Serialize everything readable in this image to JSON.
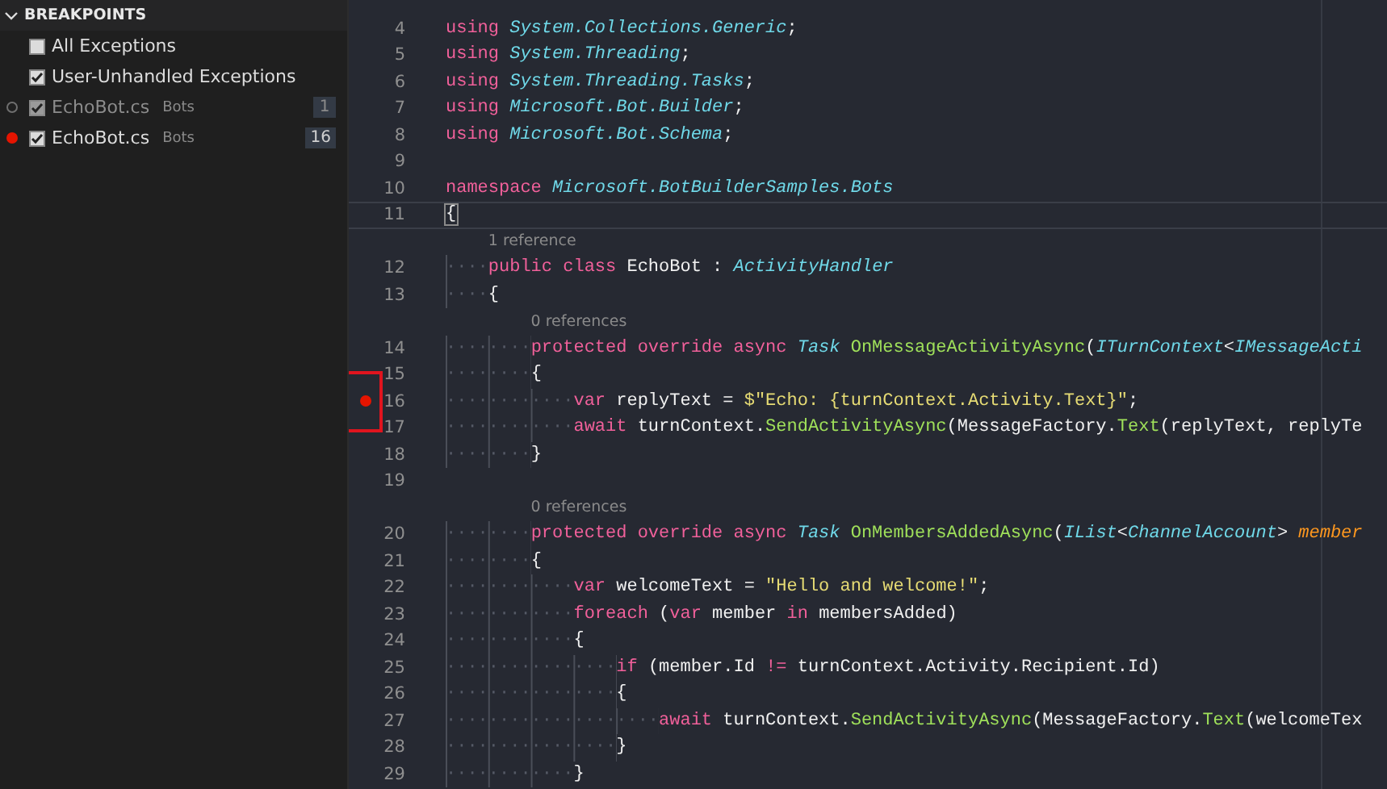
{
  "sidebar": {
    "header": "BREAKPOINTS",
    "expanded": true,
    "items": [
      {
        "kind": "exception",
        "label": "All Exceptions",
        "checked": false
      },
      {
        "kind": "exception",
        "label": "User-Unhandled Exceptions",
        "checked": true
      },
      {
        "kind": "breakpoint",
        "label": "EchoBot.cs",
        "folder": "Bots",
        "line": "1",
        "checked": true,
        "enabled": false
      },
      {
        "kind": "breakpoint",
        "label": "EchoBot.cs",
        "folder": "Bots",
        "line": "16",
        "checked": true,
        "enabled": true
      }
    ]
  },
  "editor": {
    "lines": [
      {
        "kind": "code",
        "number": "4",
        "tokens": [
          {
            "kind": "keyword",
            "text": "using "
          },
          {
            "kind": "type",
            "text": "System.Collections.Generic"
          },
          {
            "kind": "plain",
            "text": ";"
          }
        ]
      },
      {
        "kind": "code",
        "number": "5",
        "tokens": [
          {
            "kind": "keyword",
            "text": "using "
          },
          {
            "kind": "type",
            "text": "System.Threading"
          },
          {
            "kind": "plain",
            "text": ";"
          }
        ]
      },
      {
        "kind": "code",
        "number": "6",
        "tokens": [
          {
            "kind": "keyword",
            "text": "using "
          },
          {
            "kind": "type",
            "text": "System.Threading.Tasks"
          },
          {
            "kind": "plain",
            "text": ";"
          }
        ]
      },
      {
        "kind": "code",
        "number": "7",
        "tokens": [
          {
            "kind": "keyword",
            "text": "using "
          },
          {
            "kind": "type",
            "text": "Microsoft.Bot.Builder"
          },
          {
            "kind": "plain",
            "text": ";"
          }
        ]
      },
      {
        "kind": "code",
        "number": "8",
        "tokens": [
          {
            "kind": "keyword",
            "text": "using "
          },
          {
            "kind": "type",
            "text": "Microsoft.Bot.Schema"
          },
          {
            "kind": "plain",
            "text": ";"
          }
        ]
      },
      {
        "kind": "code",
        "number": "9"
      },
      {
        "kind": "code",
        "number": "10",
        "tokens": [
          {
            "kind": "keyword",
            "text": "namespace "
          },
          {
            "kind": "type",
            "text": "Microsoft.BotBuilderSamples.Bots"
          }
        ]
      },
      {
        "kind": "code",
        "number": "11",
        "current": true,
        "tokens": [
          {
            "kind": "bracket",
            "text": "{"
          }
        ]
      },
      {
        "kind": "lens",
        "text": "1 reference"
      },
      {
        "kind": "code",
        "number": "12",
        "indent": "····",
        "tokens": [
          {
            "kind": "keyword",
            "text": "public class "
          },
          {
            "kind": "plain",
            "text": "EchoBot : "
          },
          {
            "kind": "type",
            "text": "ActivityHandler"
          }
        ]
      },
      {
        "kind": "code",
        "number": "13",
        "indent": "····",
        "tokens": [
          {
            "kind": "plain",
            "text": "{"
          }
        ]
      },
      {
        "kind": "lens",
        "text": "0 references"
      },
      {
        "kind": "code",
        "number": "14",
        "indent": "········",
        "tokens": [
          {
            "kind": "keyword",
            "text": "protected override async "
          },
          {
            "kind": "type",
            "text": "Task "
          },
          {
            "kind": "function",
            "text": "OnMessageActivityAsync"
          },
          {
            "kind": "plain",
            "text": "("
          },
          {
            "kind": "type",
            "text": "ITurnContext"
          },
          {
            "kind": "plain",
            "text": "<"
          },
          {
            "kind": "type",
            "text": "IMessageActi"
          }
        ]
      },
      {
        "kind": "code",
        "number": "15",
        "indent": "········",
        "tokens": [
          {
            "kind": "plain",
            "text": "{"
          }
        ]
      },
      {
        "kind": "code",
        "number": "16",
        "indent": "············",
        "breakpoint": true,
        "marked": true,
        "tokens": [
          {
            "kind": "keyword",
            "text": "var "
          },
          {
            "kind": "plain",
            "text": "replyText = "
          },
          {
            "kind": "string",
            "text": "$\"Echo: {turnContext.Activity.Text}\""
          },
          {
            "kind": "plain",
            "text": ";"
          }
        ]
      },
      {
        "kind": "code",
        "number": "17",
        "indent": "············",
        "tokens": [
          {
            "kind": "keyword",
            "text": "await "
          },
          {
            "kind": "plain",
            "text": "turnContext."
          },
          {
            "kind": "function",
            "text": "SendActivityAsync"
          },
          {
            "kind": "plain",
            "text": "(MessageFactory."
          },
          {
            "kind": "function",
            "text": "Text"
          },
          {
            "kind": "plain",
            "text": "(replyText, replyTe"
          }
        ]
      },
      {
        "kind": "code",
        "number": "18",
        "indent": "········",
        "tokens": [
          {
            "kind": "plain",
            "text": "}"
          }
        ]
      },
      {
        "kind": "code",
        "number": "19"
      },
      {
        "kind": "lens",
        "text": "0 references"
      },
      {
        "kind": "code",
        "number": "20",
        "indent": "········",
        "tokens": [
          {
            "kind": "keyword",
            "text": "protected override async "
          },
          {
            "kind": "type",
            "text": "Task "
          },
          {
            "kind": "function",
            "text": "OnMembersAddedAsync"
          },
          {
            "kind": "plain",
            "text": "("
          },
          {
            "kind": "type",
            "text": "IList"
          },
          {
            "kind": "plain",
            "text": "<"
          },
          {
            "kind": "type",
            "text": "ChannelAccount"
          },
          {
            "kind": "plain",
            "text": ">"
          },
          {
            "kind": "param",
            "text": " member"
          }
        ]
      },
      {
        "kind": "code",
        "number": "21",
        "indent": "········",
        "tokens": [
          {
            "kind": "plain",
            "text": "{"
          }
        ]
      },
      {
        "kind": "code",
        "number": "22",
        "indent": "············",
        "tokens": [
          {
            "kind": "keyword",
            "text": "var "
          },
          {
            "kind": "plain",
            "text": "welcomeText = "
          },
          {
            "kind": "string",
            "text": "\"Hello and welcome!\""
          },
          {
            "kind": "plain",
            "text": ";"
          }
        ]
      },
      {
        "kind": "code",
        "number": "23",
        "indent": "············",
        "tokens": [
          {
            "kind": "keyword",
            "text": "foreach "
          },
          {
            "kind": "plain",
            "text": "("
          },
          {
            "kind": "keyword",
            "text": "var "
          },
          {
            "kind": "plain",
            "text": "member "
          },
          {
            "kind": "keyword",
            "text": "in "
          },
          {
            "kind": "plain",
            "text": "membersAdded)"
          }
        ]
      },
      {
        "kind": "code",
        "number": "24",
        "indent": "············",
        "tokens": [
          {
            "kind": "plain",
            "text": "{"
          }
        ]
      },
      {
        "kind": "code",
        "number": "25",
        "indent": "················",
        "tokens": [
          {
            "kind": "keyword",
            "text": "if "
          },
          {
            "kind": "plain",
            "text": "(member.Id "
          },
          {
            "kind": "keyword",
            "text": "!= "
          },
          {
            "kind": "plain",
            "text": "turnContext.Activity.Recipient.Id)"
          }
        ]
      },
      {
        "kind": "code",
        "number": "26",
        "indent": "················",
        "tokens": [
          {
            "kind": "plain",
            "text": "{"
          }
        ]
      },
      {
        "kind": "code",
        "number": "27",
        "indent": "····················",
        "tokens": [
          {
            "kind": "keyword",
            "text": "await "
          },
          {
            "kind": "plain",
            "text": "turnContext."
          },
          {
            "kind": "function",
            "text": "SendActivityAsync"
          },
          {
            "kind": "plain",
            "text": "(MessageFactory."
          },
          {
            "kind": "function",
            "text": "Text"
          },
          {
            "kind": "plain",
            "text": "(welcomeTex"
          }
        ]
      },
      {
        "kind": "code",
        "number": "28",
        "indent": "················",
        "tokens": [
          {
            "kind": "plain",
            "text": "}"
          }
        ]
      },
      {
        "kind": "code",
        "number": "29",
        "indent": "············",
        "tokens": [
          {
            "kind": "plain",
            "text": "}"
          }
        ]
      }
    ]
  }
}
